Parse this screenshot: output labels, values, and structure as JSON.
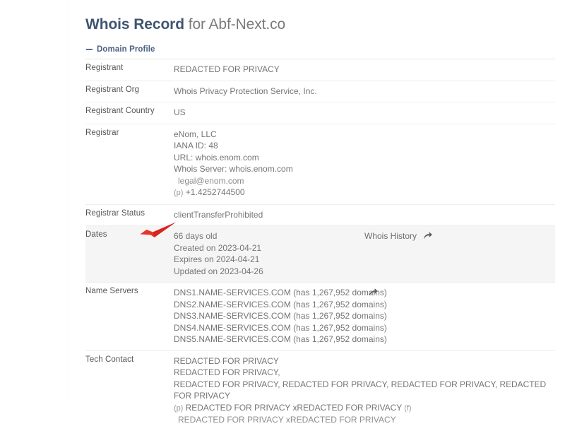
{
  "header": {
    "title_strong": "Whois Record",
    "title_rest": " for Abf-Next.co"
  },
  "section": {
    "collapse_icon": "minus-icon",
    "label": "Domain Profile"
  },
  "colors": {
    "title_accent": "#3f5571",
    "section_accent": "#4a6080",
    "label": "#555555",
    "value": "#757575",
    "row_highlight": "#f5f5f5",
    "pointer": "#e8342a"
  },
  "rows": [
    {
      "key": "Registrant",
      "lines": [
        "REDACTED FOR PRIVACY"
      ],
      "highlight": false
    },
    {
      "key": "Registrant Org",
      "lines": [
        "Whois Privacy Protection Service, Inc."
      ],
      "highlight": false
    },
    {
      "key": "Registrant Country",
      "lines": [
        "US"
      ],
      "highlight": false
    },
    {
      "key": "Registrar",
      "lines": [
        "eNom, LLC",
        "IANA ID: 48",
        "URL: whois.enom.com",
        "Whois Server: whois.enom.com"
      ],
      "sub_lines": [
        "legal@enom.com"
      ],
      "phone": {
        "tag": "(p)",
        "value": "+1.4252744500"
      },
      "highlight": false
    },
    {
      "key": "Registrar Status",
      "lines": [
        "clientTransferProhibited"
      ],
      "highlight": false
    },
    {
      "key": "Dates",
      "lines": [
        "66 days old",
        "Created on 2023-04-21",
        "Expires on 2024-04-21",
        "Updated on 2023-04-26"
      ],
      "action": {
        "label": "Whois History",
        "icon": "share-arrow-icon"
      },
      "highlight": true
    },
    {
      "key": "Name Servers",
      "lines": [
        "DNS1.NAME-SERVICES.COM (has 1,267,952 domains)",
        "DNS2.NAME-SERVICES.COM (has 1,267,952 domains)",
        "DNS3.NAME-SERVICES.COM (has 1,267,952 domains)",
        "DNS4.NAME-SERVICES.COM (has 1,267,952 domains)",
        "DNS5.NAME-SERVICES.COM (has 1,267,952 domains)"
      ],
      "action": {
        "label": "",
        "icon": "share-arrow-icon"
      },
      "highlight": false
    },
    {
      "key": "Tech Contact",
      "lines": [
        "REDACTED FOR PRIVACY",
        "REDACTED FOR PRIVACY,",
        "REDACTED FOR PRIVACY, REDACTED FOR PRIVACY, REDACTED FOR PRIVACY, REDACTED FOR PRIVACY"
      ],
      "phone_fax": {
        "p_tag": "(p)",
        "p_value": "REDACTED FOR PRIVACY xREDACTED FOR PRIVACY",
        "f_tag": "(f)",
        "f_value": "REDACTED FOR PRIVACY xREDACTED FOR PRIVACY"
      },
      "highlight": false
    }
  ]
}
